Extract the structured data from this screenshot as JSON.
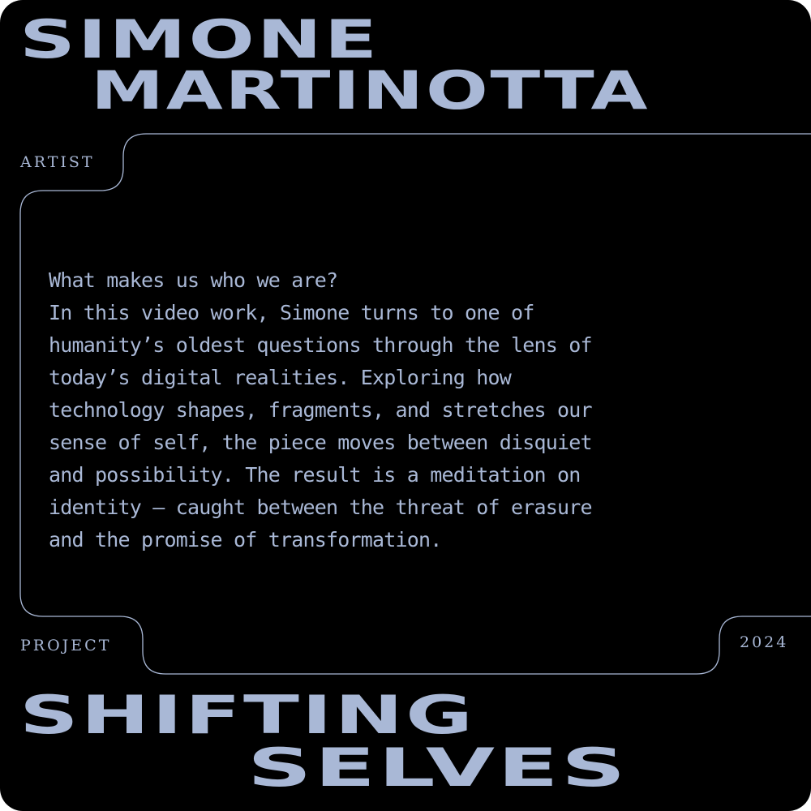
{
  "artist": {
    "first_name": "SIMONE",
    "last_name": "MARTINOTTA",
    "label": "ARTIST"
  },
  "project": {
    "label": "PROJECT",
    "year": "2024",
    "title_line_1": "SHIFTING",
    "title_line_2": "SELVES"
  },
  "description": {
    "lines": [
      "What makes us who we are?",
      "In this video work, Simone turns to one of",
      "humanity’s oldest questions through the lens of",
      "today’s digital realities. Exploring how",
      "technology shapes, fragments, and stretches our",
      "sense of self, the piece moves between disquiet",
      "and possibility. The result is a meditation on",
      "identity – caught between the threat of erasure",
      "and the promise of transformation."
    ]
  },
  "colors": {
    "background": "#000000",
    "accent": "#a9b8d6",
    "outer": "#ffffff"
  }
}
